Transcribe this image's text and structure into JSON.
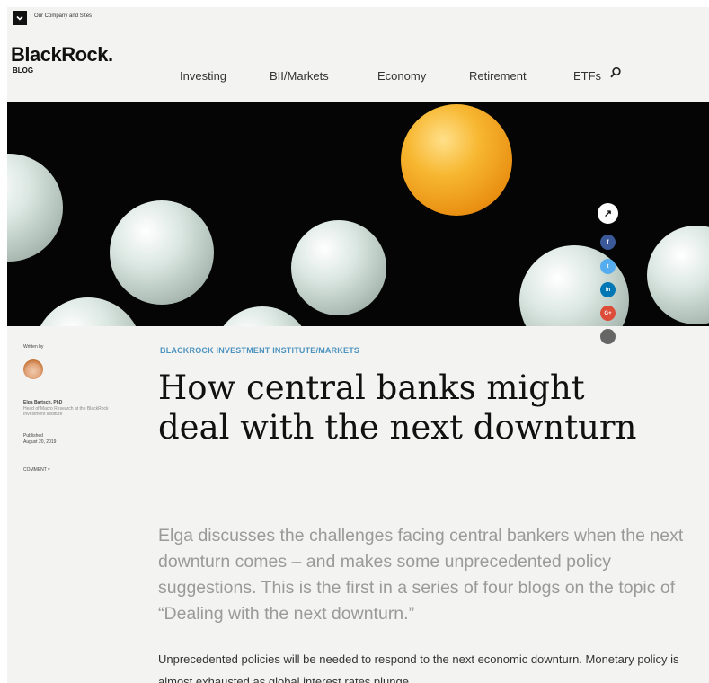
{
  "utility_bar": {
    "label": "Our Company and Sites"
  },
  "header": {
    "logo": "BlackRock.",
    "logo_sub": "BLOG",
    "nav": [
      "Investing",
      "BII/Markets",
      "Economy",
      "Retirement",
      "ETFs"
    ]
  },
  "share_rail": {
    "icons": [
      "share-icon",
      "facebook-icon",
      "twitter-icon",
      "linkedin-icon",
      "googleplus-icon",
      "email-icon"
    ],
    "colors": [
      "#ffffff",
      "#3b5998",
      "#55acee",
      "#0077b5",
      "#dd4b39",
      "#666666"
    ],
    "glyphs": [
      "↗",
      "f",
      "t",
      "in",
      "G+",
      ""
    ]
  },
  "author": {
    "written_by": "Written by",
    "name": "Elga Bartsch, PhD",
    "role": "Head of Macro Research at the BlackRock Investment Institute",
    "published_label": "Published",
    "published_date": "August 20, 2019",
    "comment": "COMMENT ▾"
  },
  "article": {
    "category": "BLACKROCK INVESTMENT INSTITUTE/MARKETS",
    "title": "How central banks might deal with the next downturn",
    "deck": "Elga discusses the challenges facing central bankers when the next downturn comes – and makes some unprecedented policy suggestions. This is the first in a series of four blogs on the topic of “Dealing with the next downturn.”",
    "body": "Unprecedented policies will be needed to respond to the next economic downturn. Monetary policy is almost exhausted as global interest rates plunge"
  },
  "colors": {
    "accent": "#4d93bf",
    "background": "#f3f3f1",
    "hero": "#050505"
  }
}
